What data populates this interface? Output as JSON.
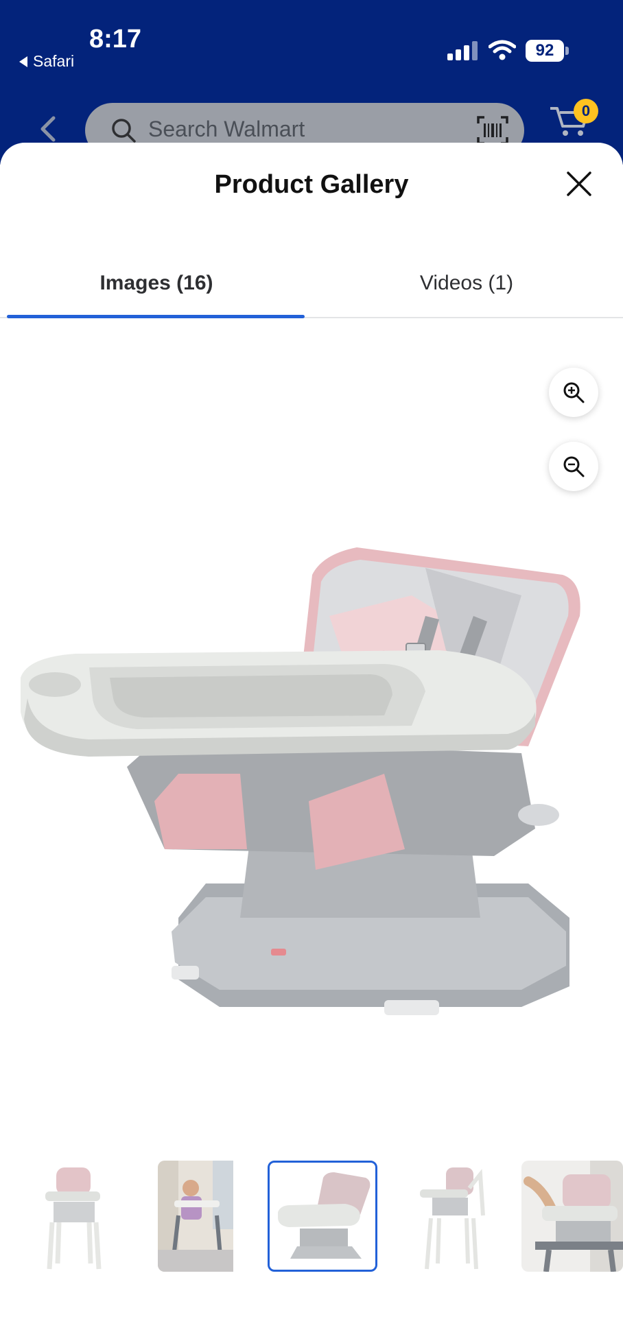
{
  "status_bar": {
    "time": "8:17",
    "back_app": "Safari",
    "battery": "92"
  },
  "header": {
    "search_placeholder": "Search Walmart",
    "cart_count": "0",
    "icons": [
      "back-chevron-icon",
      "search-icon",
      "barcode-scanner-icon",
      "cart-icon"
    ]
  },
  "sheet": {
    "title": "Product Gallery",
    "tabs": [
      {
        "label": "Images (16)",
        "active": true
      },
      {
        "label": "Videos (1)",
        "active": false
      }
    ],
    "zoom": {
      "in": "zoom-in-icon",
      "out": "zoom-out-icon"
    },
    "thumbnails": [
      {
        "name": "thumbnail-1",
        "active": false
      },
      {
        "name": "thumbnail-2",
        "active": false
      },
      {
        "name": "thumbnail-3",
        "active": true
      },
      {
        "name": "thumbnail-4",
        "active": false
      },
      {
        "name": "thumbnail-5",
        "active": false
      }
    ]
  },
  "colors": {
    "header_blue": "#03237b",
    "accent_blue": "#2261d8",
    "badge_yellow": "#ffc220",
    "fabric_pink": "#f2c3c8",
    "plastic_gray": "#b8bbbf"
  }
}
